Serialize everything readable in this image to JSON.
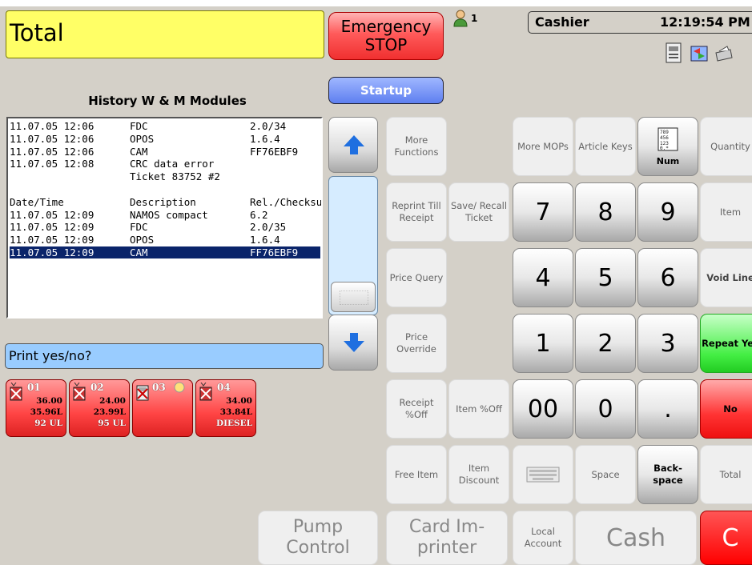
{
  "total": {
    "label": "Total"
  },
  "emergency": {
    "line1": "Emergency",
    "line2": "STOP"
  },
  "users": {
    "count": "1"
  },
  "header": {
    "role": "Cashier",
    "time": "12:19:54 PM"
  },
  "startup": {
    "label": "Startup"
  },
  "history": {
    "title": "History W & M Modules",
    "lines": [
      {
        "date": "11.07.05 12:06",
        "desc": "FDC",
        "rel": "2.0/34"
      },
      {
        "date": "11.07.05 12:06",
        "desc": "OPOS",
        "rel": "1.6.4"
      },
      {
        "date": "11.07.05 12:06",
        "desc": "CAM",
        "rel": "FF76EBF9"
      },
      {
        "date": "11.07.05 12:08",
        "desc": "CRC data error",
        "rel": ""
      },
      {
        "date": "",
        "desc": "Ticket 83752 #2",
        "rel": ""
      },
      {
        "date": "",
        "desc": "",
        "rel": ""
      },
      {
        "date": "Date/Time",
        "desc": "Description",
        "rel": "Rel./Checksum"
      },
      {
        "date": "11.07.05 12:09",
        "desc": "NAMOS compact",
        "rel": "6.2"
      },
      {
        "date": "11.07.05 12:09",
        "desc": "FDC",
        "rel": "2.0/35"
      },
      {
        "date": "11.07.05 12:09",
        "desc": "OPOS",
        "rel": "1.6.4"
      },
      {
        "date": "11.07.05 12:09",
        "desc": "CAM",
        "rel": "FF76EBF9"
      }
    ]
  },
  "prompt": {
    "text": "Print yes/no?"
  },
  "pumps": [
    {
      "num": "01",
      "amount": "36.00",
      "volume": "35.96L",
      "grade": "92 UL"
    },
    {
      "num": "02",
      "amount": "24.00",
      "volume": "23.99L",
      "grade": "95 UL"
    },
    {
      "num": "03",
      "amount": "",
      "volume": "",
      "grade": ""
    },
    {
      "num": "04",
      "amount": "34.00",
      "volume": "33.84L",
      "grade": "DIESEL"
    }
  ],
  "buttons": {
    "more_functions": "More Functions",
    "reprint": "Reprint Till Receipt",
    "save_recall": "Save/ Recall Ticket",
    "price_query": "Price Query",
    "price_override": "Price Override",
    "receipt_off": "Receipt %Off",
    "item_off": "Item %Off",
    "free_item": "Free Item",
    "item_discount": "Item Discount",
    "more_mops": "More MOPs",
    "article_keys": "Article Keys",
    "num_label": "Num",
    "quantity": "Quantity",
    "item": "Item",
    "void_line": "Void Line",
    "repeat_yes": "Repeat Yes",
    "no": "No",
    "total": "Total",
    "space": "Space",
    "backspace": "Back- space",
    "pump_control": "Pump Control",
    "card_imprinter": "Card Im- printer",
    "local_account": "Local Account",
    "cash": "Cash",
    "c": "C"
  },
  "numpad": {
    "k7": "7",
    "k8": "8",
    "k9": "9",
    "k4": "4",
    "k5": "5",
    "k6": "6",
    "k1": "1",
    "k2": "2",
    "k3": "3",
    "k00": "00",
    "k0": "0",
    "kdot": "."
  },
  "colors": {
    "total_bg": "#ffff66",
    "prompt_bg": "#99ccff",
    "startup_bg": "#5e7ff0",
    "emergency_bg": "#f03030",
    "repeat_bg": "#44ee44",
    "no_bg": "#ff3333",
    "selection_bg": "#0a246a"
  }
}
